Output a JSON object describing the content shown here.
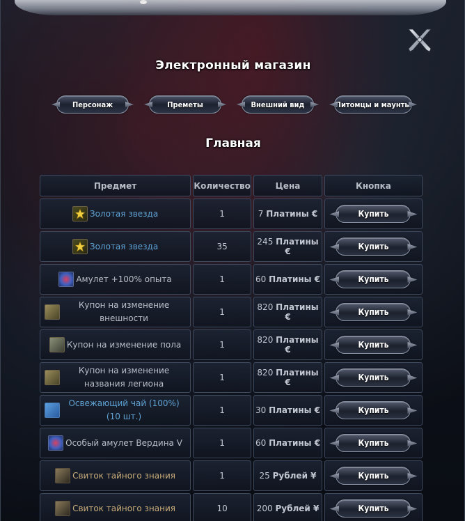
{
  "window": {
    "title": "Электронный магазин",
    "close_icon": "close-x-icon"
  },
  "tabs": [
    {
      "label": "Персонаж"
    },
    {
      "label": "Преметы"
    },
    {
      "label": "Внешний вид"
    },
    {
      "label": "Питомцы и маунты"
    }
  ],
  "section": {
    "title": "Главная"
  },
  "table": {
    "headers": {
      "item": "Предмет",
      "quantity": "Количество",
      "price": "Цена",
      "button": "Кнопка"
    },
    "buy_label": "Купить",
    "rows": [
      {
        "icon": "gold-star-icon",
        "name": "Золотая звезда",
        "quantity": "1",
        "price": "7",
        "currency": "Платины €"
      },
      {
        "icon": "gold-star-icon",
        "name": "Золотая звезда",
        "quantity": "35",
        "price": "245",
        "currency": "Платины €"
      },
      {
        "icon": "amulet-icon",
        "name": "Амулет +100% опыта",
        "quantity": "1",
        "price": "60",
        "currency": "Платины €"
      },
      {
        "icon": "coupon-icon",
        "name": "Купон на изменение внешности",
        "quantity": "1",
        "price": "820",
        "currency": "Платины €"
      },
      {
        "icon": "coupon-icon",
        "name": "Купон на изменение пола",
        "quantity": "1",
        "price": "820",
        "currency": "Платины €"
      },
      {
        "icon": "coupon-icon",
        "name": "Купон на изменение названия легиона",
        "quantity": "1",
        "price": "820",
        "currency": "Платины €"
      },
      {
        "icon": "tea-icon",
        "name": "Освежающий чай (100%) (10 шт.)",
        "quantity": "1",
        "price": "30",
        "currency": "Платины €"
      },
      {
        "icon": "amulet-icon",
        "name": "Особый амулет Вердина V",
        "quantity": "1",
        "price": "60",
        "currency": "Платины €"
      },
      {
        "icon": "scroll-icon",
        "name": "Свиток тайного знания",
        "quantity": "1",
        "price": "25",
        "currency": "Рублей ¥"
      },
      {
        "icon": "scroll-icon",
        "name": "Свиток тайного знания",
        "quantity": "10",
        "price": "200",
        "currency": "Рублей ¥"
      }
    ]
  },
  "colors": {
    "name_blue": "#5fa3d4",
    "name_grey": "#b9bec8",
    "name_gold": "#c9ad7a"
  }
}
